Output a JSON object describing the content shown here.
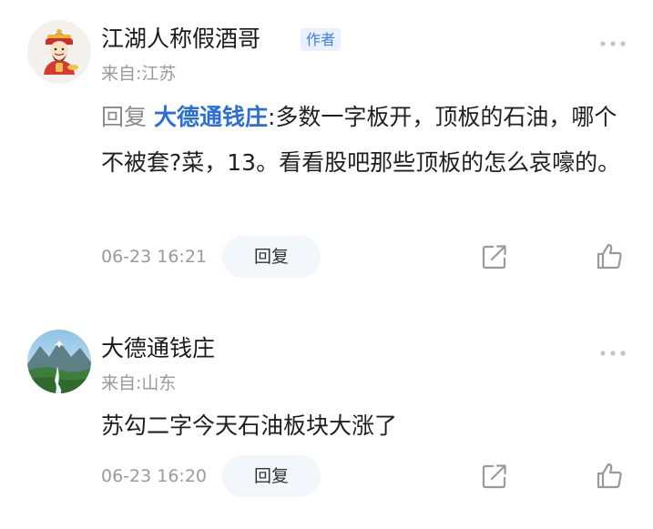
{
  "comments": [
    {
      "username": "江湖人称假酒哥",
      "badge": "作者",
      "location": "来自:江苏",
      "reply_prefix": "回复",
      "reply_target": "大德通钱庄",
      "reply_colon": ":",
      "text": "多数一字板开，顶板的石油，哪个不被套?菜，13。看看股吧那些顶板的怎么哀嚎的。",
      "timestamp": "06-23 16:21",
      "reply_label": "回复",
      "avatar_icon": "god-of-wealth-avatar"
    },
    {
      "username": "大德通钱庄",
      "location": "来自:山东",
      "text": "苏勾二字今天石油板块大涨了",
      "timestamp": "06-23 16:20",
      "reply_label": "回复",
      "avatar_icon": "landscape-avatar"
    }
  ],
  "colors": {
    "link_blue": "#2b6fd6",
    "badge_bg": "#e8f1ff",
    "badge_text": "#3a7ee6",
    "muted_text": "#9a9a9a",
    "reply_button_bg": "#f3f6fb"
  }
}
